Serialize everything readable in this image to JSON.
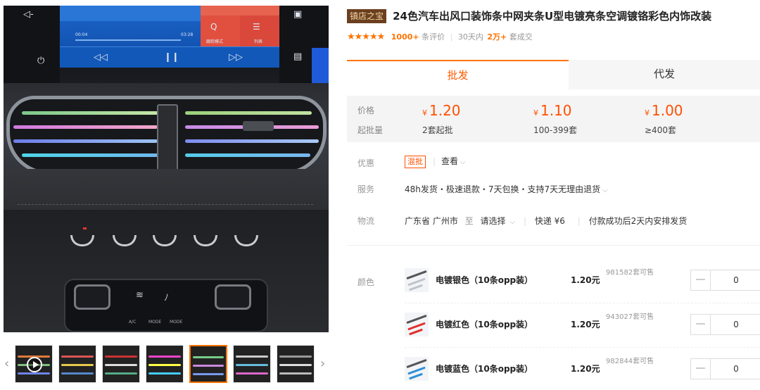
{
  "gallery": {
    "screen": {
      "time_elapsed": "00:04",
      "time_total": "03:28",
      "tile_label_1": "跟踪模式",
      "tile_label_2": "列表"
    },
    "ac_panel": {
      "label_ac": "A/C",
      "label_mode1": "MODE",
      "label_mode2": "MODE"
    },
    "prev_arrow": "‹",
    "next_arrow": "›",
    "thumbnails": [
      {
        "colors": [
          "#e07a3a",
          "#7fbf7f",
          "#6f83e8"
        ],
        "video": true
      },
      {
        "colors": [
          "#d55",
          "#e8c84a",
          "#58c"
        ]
      },
      {
        "colors": [
          "#c33",
          "#ddd",
          "#5a8"
        ]
      },
      {
        "colors": [
          "#e4c",
          "#ff4",
          "#4cf"
        ]
      },
      {
        "colors": [
          "#7c8",
          "#c8d",
          "#79e"
        ],
        "active": true
      },
      {
        "colors": [
          "#ccc",
          "#6bd",
          "#d6c"
        ]
      },
      {
        "colors": [
          "#999",
          "#ddd",
          "#bbb"
        ]
      }
    ]
  },
  "product": {
    "badge": "镇店之宝",
    "title": "24色汽车出风口装饰条中网夹条U型电镀亮条空调镀铬彩色内饰改装",
    "stars": "★★★★★",
    "review_count": "1000+",
    "review_label": "条评价",
    "sales_prefix": "30天内",
    "sales_count": "2万+",
    "sales_suffix": "套成交"
  },
  "tabs": [
    {
      "label": "批发",
      "active": true
    },
    {
      "label": "代发",
      "active": false
    }
  ],
  "pricing": {
    "price_label": "价格",
    "moq_label": "起批量",
    "currency": "¥",
    "tiers": [
      {
        "price": "1.20",
        "qty": "2套起批"
      },
      {
        "price": "1.10",
        "qty": "100-399套"
      },
      {
        "price": "1.00",
        "qty": "≥400套"
      }
    ]
  },
  "promo": {
    "label": "优惠",
    "tag": "混批",
    "link": "查看"
  },
  "service": {
    "label": "服务",
    "text": "48h发货・极速退款・7天包换・支持7天无理由退货"
  },
  "logistics": {
    "label": "物流",
    "origin": "广东省 广州市",
    "to": "至",
    "destination": "请选择",
    "shipping": "快递 ¥6",
    "note": "付款成功后2天内安排发货"
  },
  "color_label": "颜色",
  "skus": [
    {
      "name": "电镀银色（10条opp装）",
      "price": "1.20元",
      "stock": "981582套可售",
      "qty": "0",
      "swatch": "#c0c4ca"
    },
    {
      "name": "电镀红色（10条opp装）",
      "price": "1.20元",
      "stock": "943027套可售",
      "qty": "0",
      "swatch": "#e0312c"
    },
    {
      "name": "电镀蓝色（10条opp装）",
      "price": "1.20元",
      "stock": "982844套可售",
      "qty": "0",
      "swatch": "#2d8fd6"
    }
  ],
  "stepper_minus": "—"
}
